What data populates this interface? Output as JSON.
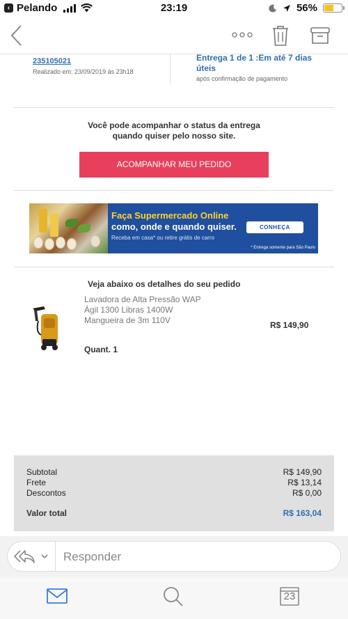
{
  "status_bar": {
    "back_app_label": "Pelando",
    "time": "23:19",
    "battery": "56%",
    "battery_level": 0.56
  },
  "order": {
    "number": "235105021",
    "date": "Realizado em: 23/09/2019 às 23h18",
    "delivery_title": "Entrega 1 de 1 :Em até 7 dias úteis",
    "delivery_note": "após confirmação de pagamento"
  },
  "tracking": {
    "text_line1": "Você pode acompanhar o status da entrega",
    "text_line2": "quando quiser pelo nosso site.",
    "button_label": "ACOMPANHAR MEU PEDIDO",
    "button_color": "#e8405c"
  },
  "banner": {
    "title_line1": "Faça Supermercado Online",
    "title_line2": "como, onde e quando quiser.",
    "subtitle": "Receba em casa* ou retire grátis de carro",
    "cta": "CONHEÇA",
    "footnote": "* Entrega somente para São Paulo"
  },
  "details": {
    "title": "Veja abaixo os detalhes do seu pedido",
    "product_name": "Lavadora de Alta Pressão WAP Ágil 1300 Libras 1400W Mangueira de 3m 110V",
    "product_price": "R$ 149,90",
    "quantity": "Quant. 1"
  },
  "summary": {
    "subtotal_label": "Subtotal",
    "subtotal_value": "R$ 149,90",
    "shipping_label": "Frete",
    "shipping_value": "R$ 13,14",
    "discount_label": "Descontos",
    "discount_value": "R$ 0,00",
    "total_label": "Valor total",
    "total_value": "R$ 163,04"
  },
  "reply": {
    "placeholder": "Responder"
  },
  "tab_bar": {
    "calendar_day": "23",
    "active_color": "#3a7bd5"
  }
}
